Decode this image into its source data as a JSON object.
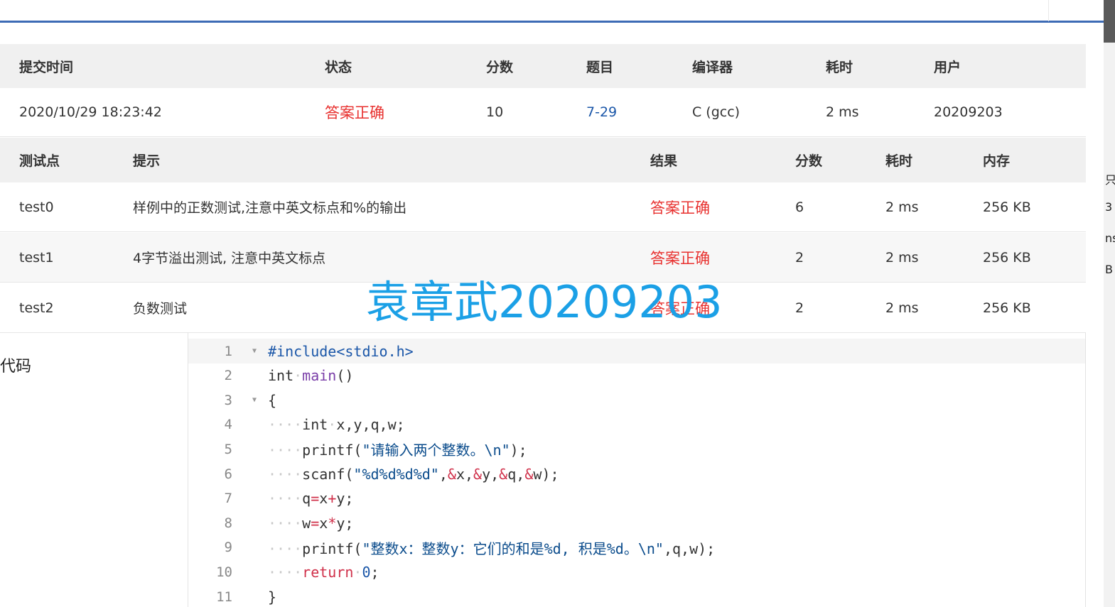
{
  "submission": {
    "headers": [
      "提交时间",
      "状态",
      "分数",
      "题目",
      "编译器",
      "耗时",
      "用户"
    ],
    "row": {
      "time": "2020/10/29 18:23:42",
      "status": "答案正确",
      "score": "10",
      "problem": "7-29",
      "compiler": "C (gcc)",
      "elapsed": "2 ms",
      "user": "20209203"
    }
  },
  "tests": {
    "headers": [
      "测试点",
      "提示",
      "结果",
      "分数",
      "耗时",
      "内存"
    ],
    "rows": [
      {
        "id": "test0",
        "hint": "样例中的正数测试,注意中英文标点和%的输出",
        "result": "答案正确",
        "score": "6",
        "time": "2 ms",
        "memory": "256 KB"
      },
      {
        "id": "test1",
        "hint": "4字节溢出测试, 注意中英文标点",
        "result": "答案正确",
        "score": "2",
        "time": "2 ms",
        "memory": "256 KB"
      },
      {
        "id": "test2",
        "hint": "负数测试",
        "result": "答案正确",
        "score": "2",
        "time": "2 ms",
        "memory": "256 KB"
      }
    ]
  },
  "watermark": "袁章武20209203",
  "code": {
    "label": "代码",
    "lines": [
      {
        "n": "1",
        "html_segments": [
          [
            "kw-inc",
            "#include<stdio.h>"
          ]
        ]
      },
      {
        "n": "2",
        "html_segments": [
          [
            "kw",
            "int"
          ],
          [
            "ws",
            "·"
          ],
          [
            "fn",
            "main"
          ],
          [
            "kw",
            "()"
          ]
        ]
      },
      {
        "n": "3",
        "html_segments": [
          [
            "kw",
            "{"
          ]
        ]
      },
      {
        "n": "4",
        "html_segments": [
          [
            "ws",
            "····"
          ],
          [
            "kw",
            "int"
          ],
          [
            "ws",
            "·"
          ],
          [
            "kw",
            "x,y,q,w;"
          ]
        ]
      },
      {
        "n": "5",
        "html_segments": [
          [
            "ws",
            "····"
          ],
          [
            "kw",
            "printf("
          ],
          [
            "str",
            "\"请输入两个整数。\\n\""
          ],
          [
            "kw",
            ");"
          ]
        ]
      },
      {
        "n": "6",
        "html_segments": [
          [
            "ws",
            "····"
          ],
          [
            "kw",
            "scanf("
          ],
          [
            "str",
            "\"%d%d%d%d\""
          ],
          [
            "kw",
            ","
          ],
          [
            "op",
            "&"
          ],
          [
            "kw",
            "x,"
          ],
          [
            "op",
            "&"
          ],
          [
            "kw",
            "y,"
          ],
          [
            "op",
            "&"
          ],
          [
            "kw",
            "q,"
          ],
          [
            "op",
            "&"
          ],
          [
            "kw",
            "w);"
          ]
        ]
      },
      {
        "n": "7",
        "html_segments": [
          [
            "ws",
            "····"
          ],
          [
            "kw",
            "q"
          ],
          [
            "op",
            "="
          ],
          [
            "kw",
            "x"
          ],
          [
            "op",
            "+"
          ],
          [
            "kw",
            "y;"
          ]
        ]
      },
      {
        "n": "8",
        "html_segments": [
          [
            "ws",
            "····"
          ],
          [
            "kw",
            "w"
          ],
          [
            "op",
            "="
          ],
          [
            "kw",
            "x"
          ],
          [
            "op",
            "*"
          ],
          [
            "kw",
            "y;"
          ]
        ]
      },
      {
        "n": "9",
        "html_segments": [
          [
            "ws",
            "····"
          ],
          [
            "kw",
            "printf("
          ],
          [
            "str",
            "\"整数x：整数y：它们的和是%d, 积是%d。\\n\""
          ],
          [
            "kw",
            ",q,w);"
          ]
        ]
      },
      {
        "n": "10",
        "html_segments": [
          [
            "ws",
            "····"
          ],
          [
            "ret",
            "return"
          ],
          [
            "ws",
            "·"
          ],
          [
            "num",
            "0"
          ],
          [
            "kw",
            ";"
          ]
        ]
      },
      {
        "n": "11",
        "html_segments": [
          [
            "kw",
            "}"
          ]
        ]
      }
    ]
  },
  "right_edge_chars": [
    "只",
    "3",
    "ns",
    "B"
  ]
}
